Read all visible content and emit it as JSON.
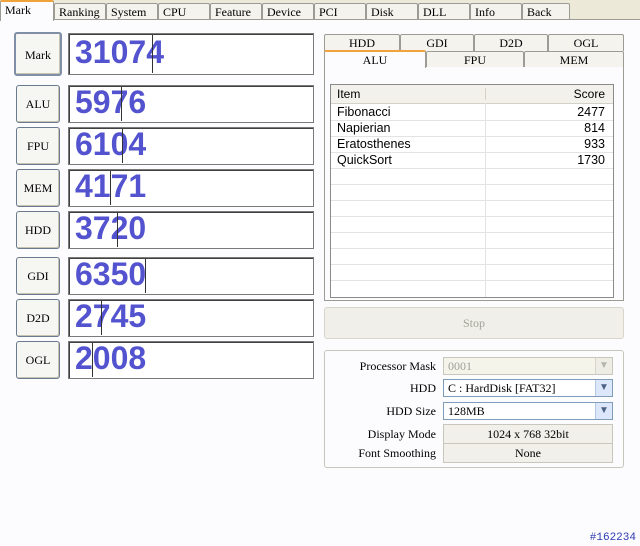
{
  "tabs": [
    "Mark",
    "Ranking",
    "System",
    "CPU",
    "Feature",
    "Device",
    "PCI",
    "Disk",
    "DLL",
    "Info",
    "Back"
  ],
  "marks": {
    "mark": {
      "label": "Mark",
      "score": "31074"
    },
    "alu": {
      "label": "ALU",
      "score": "5976"
    },
    "fpu": {
      "label": "FPU",
      "score": "6104"
    },
    "mem": {
      "label": "MEM",
      "score": "4171"
    },
    "hdd": {
      "label": "HDD",
      "score": "3720"
    },
    "gdi": {
      "label": "GDI",
      "score": "6350"
    },
    "d2d": {
      "label": "D2D",
      "score": "2745"
    },
    "ogl": {
      "label": "OGL",
      "score": "2008"
    }
  },
  "subtabs_top": [
    "HDD",
    "GDI",
    "D2D",
    "OGL"
  ],
  "subtabs_bottom": [
    "ALU",
    "FPU",
    "MEM"
  ],
  "results": {
    "headers": {
      "item": "Item",
      "score": "Score"
    },
    "rows": [
      {
        "item": "Fibonacci",
        "score": "2477"
      },
      {
        "item": "Napierian",
        "score": "814"
      },
      {
        "item": "Eratosthenes",
        "score": "933"
      },
      {
        "item": "QuickSort",
        "score": "1730"
      }
    ]
  },
  "stop_label": "Stop",
  "settings": {
    "processor_mask": {
      "label": "Processor Mask",
      "value": "0001"
    },
    "hdd": {
      "label": "HDD",
      "value": "C : HardDisk [FAT32]"
    },
    "hdd_size": {
      "label": "HDD Size",
      "value": "128MB"
    },
    "display_mode": {
      "label": "Display Mode",
      "value": "1024 x 768 32bit"
    },
    "font_smoothing": {
      "label": "Font Smoothing",
      "value": "None"
    }
  },
  "footer_id": "#162234",
  "colors": {
    "score": "#5353cf",
    "accent_tab": "#f0a33a",
    "background": "#ece9d8"
  }
}
